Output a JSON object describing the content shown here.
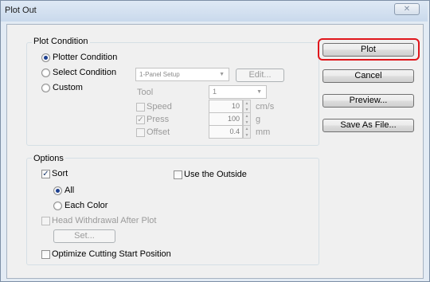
{
  "window": {
    "title": "Plot Out",
    "close_label": "✕"
  },
  "plot_condition": {
    "group_label": "Plot Condition",
    "options": {
      "plotter": "Plotter Condition",
      "select": "Select Condition",
      "custom": "Custom"
    },
    "selected": "plotter",
    "condition_select_value": "1-Panel Setup",
    "edit_label": "Edit...",
    "tool_label": "Tool",
    "tool_value": "1",
    "speed": {
      "label": "Speed",
      "checked": false,
      "value": "10",
      "unit": "cm/s"
    },
    "press": {
      "label": "Press",
      "checked": true,
      "value": "100",
      "unit": "g"
    },
    "offset": {
      "label": "Offset",
      "checked": false,
      "value": "0.4",
      "unit": "mm"
    }
  },
  "actions": {
    "plot": "Plot",
    "cancel": "Cancel",
    "preview": "Preview...",
    "save_as_file": "Save As File..."
  },
  "options": {
    "group_label": "Options",
    "sort": {
      "label": "Sort",
      "checked": true
    },
    "sort_all": "All",
    "sort_each_color": "Each Color",
    "sort_selected": "all",
    "use_outside": {
      "label": "Use the Outside",
      "checked": false
    },
    "head_withdrawal": {
      "label": "Head Withdrawal After Plot",
      "checked": false
    },
    "set_label": "Set...",
    "optimize": {
      "label": "Optimize Cutting Start Position",
      "checked": false
    }
  },
  "colors": {
    "highlight": "#e0161b",
    "titlebar": "#c9d9ec"
  },
  "icons": {
    "radio_on": "radio-selected-icon",
    "checkmark": "checkmark-icon",
    "spinner": "spinner-arrows-icon"
  }
}
